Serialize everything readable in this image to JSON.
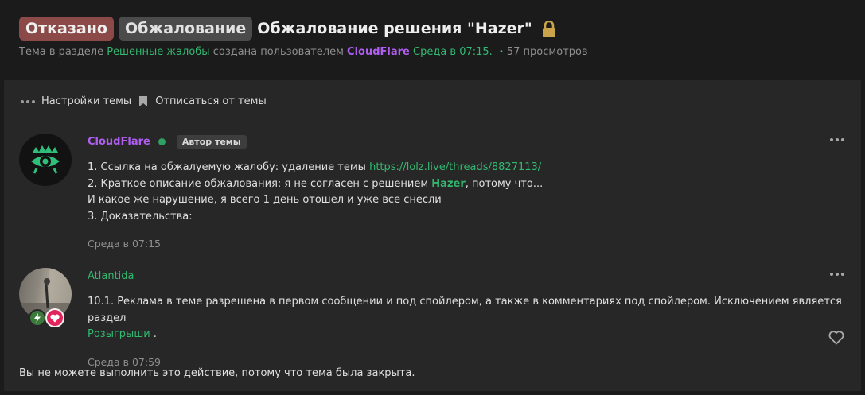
{
  "thread": {
    "status_badge": "Отказано",
    "prefix_badge": "Обжалование",
    "title": "Обжалование решения \"Hazer\"",
    "meta": {
      "prefix": "Тема в разделе",
      "section": "Решенные жалобы",
      "created_by": "создана пользователем",
      "author": "CloudFlare",
      "time": "Среда в 07:15.",
      "views": "57 просмотров"
    }
  },
  "toolbar": {
    "settings_label": "Настройки темы",
    "unsubscribe_label": "Отписаться от темы"
  },
  "posts": [
    {
      "username": "CloudFlare",
      "author_badge": "Автор темы",
      "line1_text": "1. Ссылка на обжалуемую жалобу: удаление темы ",
      "line1_link": "https://lolz.live/threads/8827113/",
      "line2_text_a": "2. Краткое описание обжалования: я не согласен с решением ",
      "line2_highlight": "Hazer",
      "line2_text_b": ", потому что...",
      "line3": "И какое же нарушение, я всего 1 день отошел и уже все снесли",
      "line4": "3. Доказательства:",
      "date": "Среда в 07:15"
    },
    {
      "username": "Atlantida",
      "text": "10.1. Реклама в теме разрешена в первом сообщении и под спойлером, а также в комментариях под спойлером. Исключением является раздел",
      "link": "Розыгрыши",
      "text_end": " .",
      "date": "Среда в 07:59"
    }
  ],
  "closed_note": "Вы не можете выполнить это действие, потому что тема была закрыта.",
  "colors": {
    "accent_green": "#32b970",
    "username_purple": "#b05ef2",
    "denied_badge": "#8b4a47"
  },
  "icons": [
    "lock-icon",
    "more-dots-icon",
    "bookmark-icon",
    "online-indicator",
    "bolt-icon",
    "heart-icon",
    "like-heart-icon"
  ]
}
